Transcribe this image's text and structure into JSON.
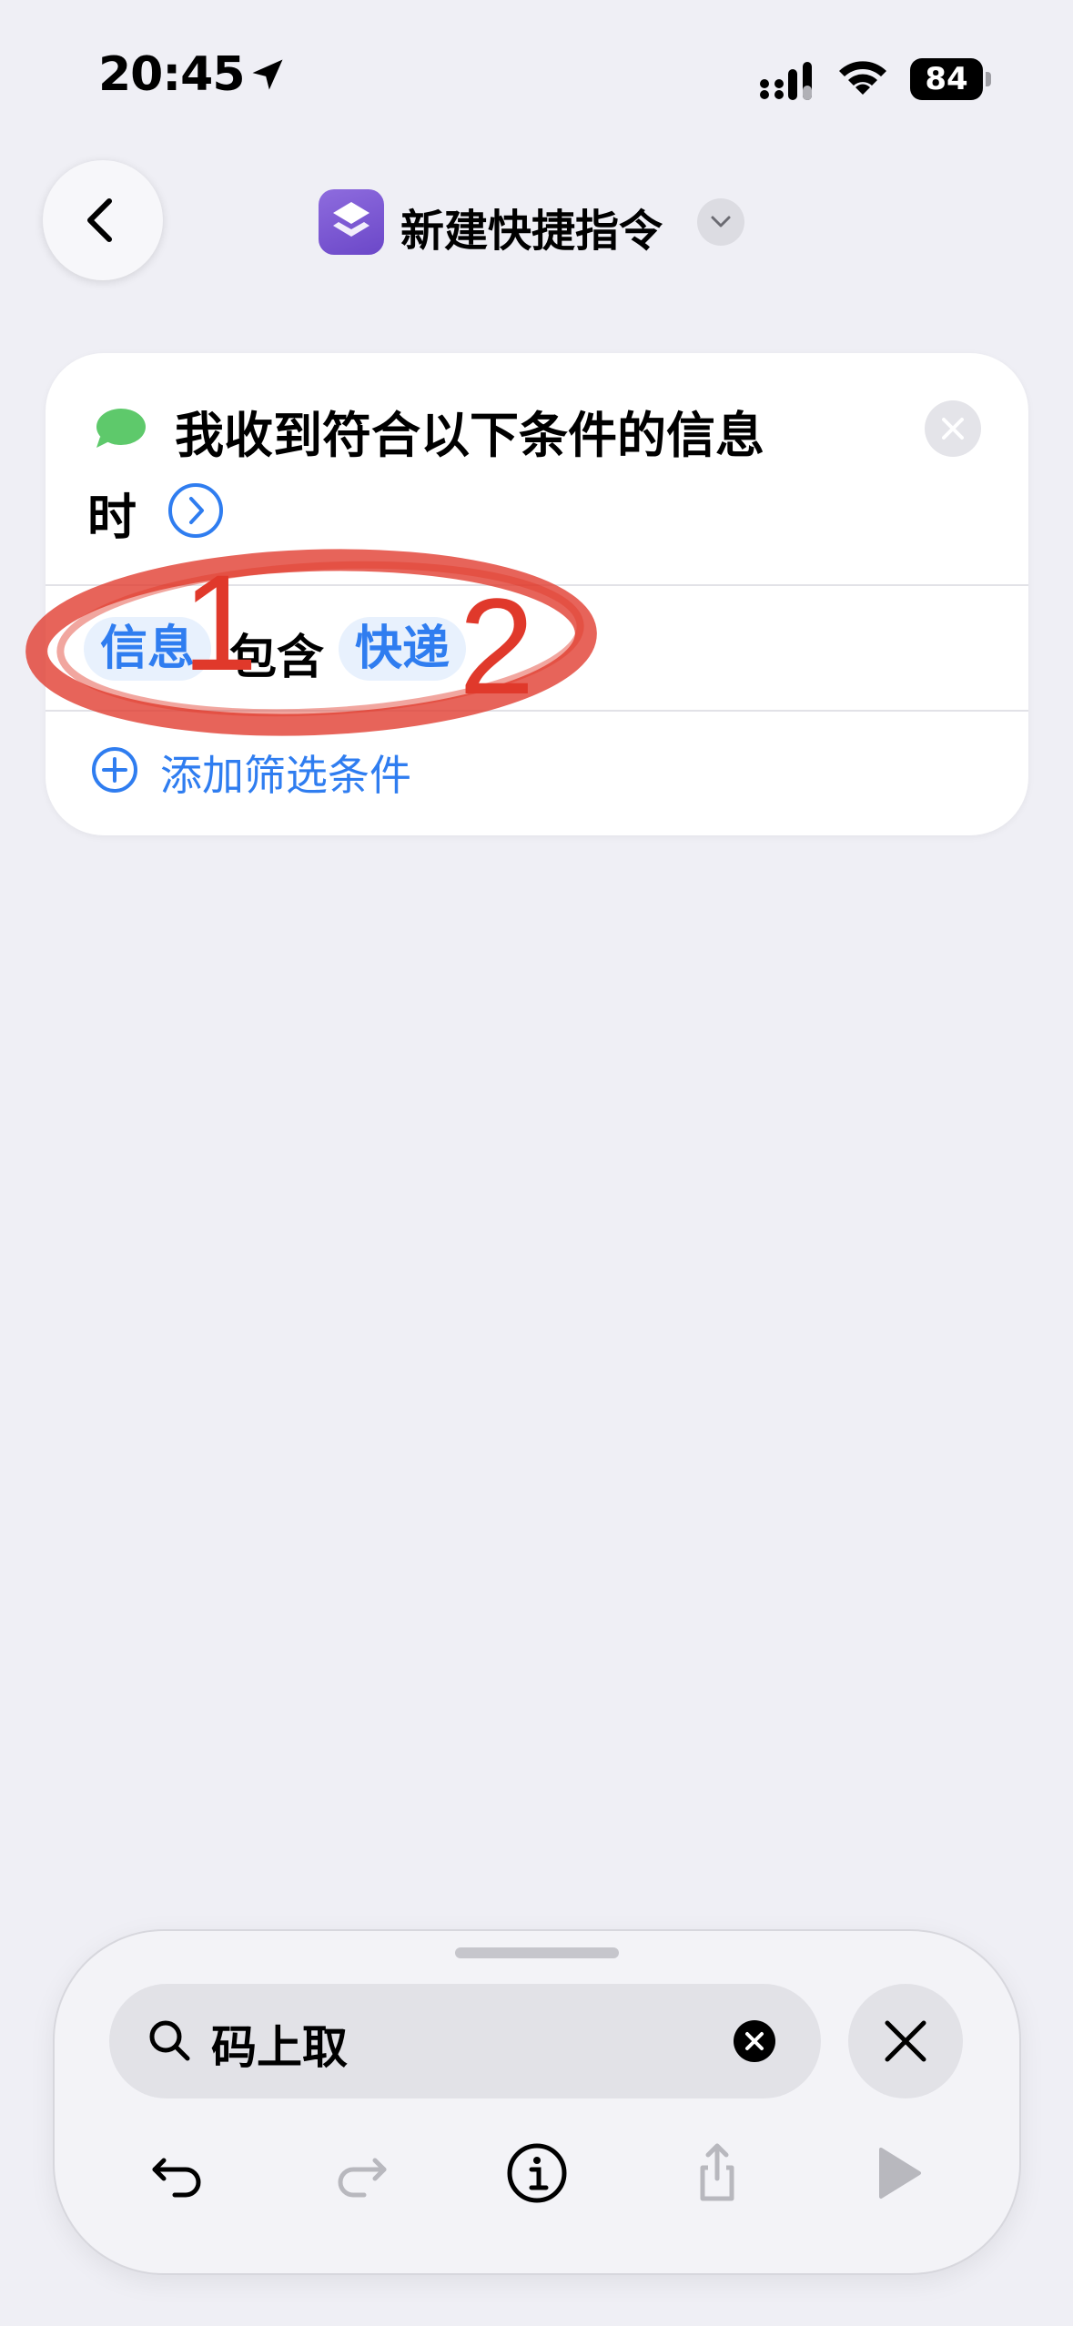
{
  "status_bar": {
    "time": "20:45",
    "battery": "84"
  },
  "nav": {
    "title": "新建快捷指令"
  },
  "trigger": {
    "title_line1": "我收到符合以下条件的信息",
    "title_line2": "时",
    "condition": {
      "field": "信息",
      "operator": "包含",
      "value": "快递"
    },
    "add_filter_label": "添加筛选条件"
  },
  "annotations": {
    "label_1": "1",
    "label_2": "2",
    "color": "#e0392b"
  },
  "search": {
    "value": "码上取"
  },
  "icons": {
    "back": "chevron-left-icon",
    "app": "shortcuts-app-icon",
    "message": "message-bubble-icon",
    "close": "close-icon",
    "arrow": "chevron-right-circle-icon",
    "add": "plus-circle-icon",
    "search": "search-icon",
    "clear": "clear-icon",
    "undo": "undo-icon",
    "redo": "redo-icon",
    "info": "info-icon",
    "share": "share-icon",
    "play": "play-icon"
  },
  "colors": {
    "accent": "#2f7df0",
    "background": "#efeff5",
    "message_green": "#5ec96b",
    "annotation_red": "#e0392b"
  }
}
